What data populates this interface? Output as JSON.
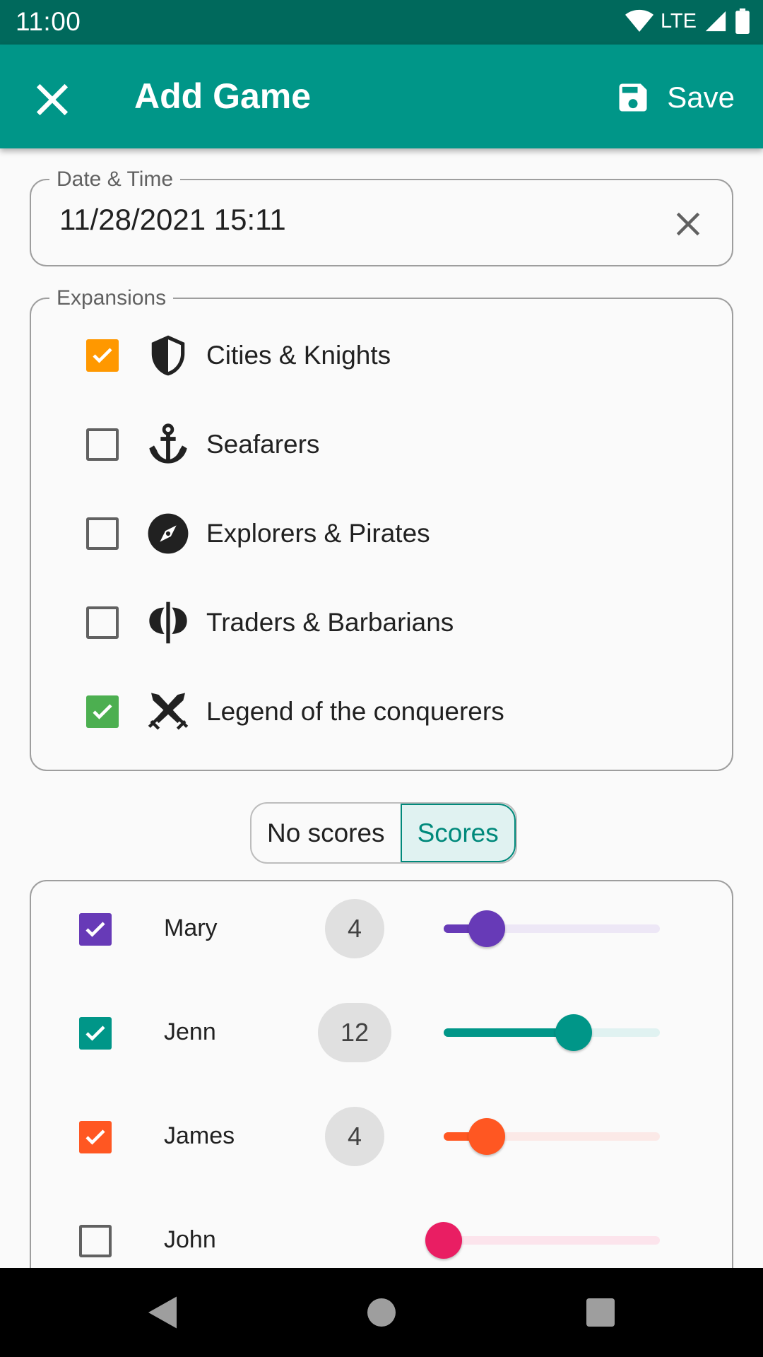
{
  "status_bar": {
    "time": "11:00",
    "network": "LTE"
  },
  "app_bar": {
    "title": "Add Game",
    "save_label": "Save"
  },
  "date_field": {
    "legend": "Date & Time",
    "value": "11/28/2021 15:11"
  },
  "expansions": {
    "legend": "Expansions",
    "items": [
      {
        "label": "Cities & Knights",
        "checked": true,
        "color": "#ff9800",
        "icon": "shield-icon"
      },
      {
        "label": "Seafarers",
        "checked": false,
        "color": "#616161",
        "icon": "anchor-icon"
      },
      {
        "label": "Explorers & Pirates",
        "checked": false,
        "color": "#616161",
        "icon": "compass-icon"
      },
      {
        "label": "Traders & Barbarians",
        "checked": false,
        "color": "#616161",
        "icon": "axe-icon"
      },
      {
        "label": "Legend of the conquerers",
        "checked": true,
        "color": "#4caf50",
        "icon": "crossed-swords-icon"
      }
    ]
  },
  "score_toggle": {
    "options": [
      "No scores",
      "Scores"
    ],
    "selected": "Scores"
  },
  "players": [
    {
      "name": "Mary",
      "checked": true,
      "score": "4",
      "slider_fraction": 0.2,
      "color": "#673ab7",
      "track": "#ede7f6"
    },
    {
      "name": "Jenn",
      "checked": true,
      "score": "12",
      "slider_fraction": 0.6,
      "color": "#009688",
      "track": "#e0f2f1"
    },
    {
      "name": "James",
      "checked": true,
      "score": "4",
      "slider_fraction": 0.2,
      "color": "#ff5722",
      "track": "#fbe9e7"
    },
    {
      "name": "John",
      "checked": false,
      "score": "",
      "slider_fraction": 0.0,
      "color": "#e91e63",
      "track": "#fce4ec"
    }
  ],
  "colors": {
    "status_bar": "#00695c",
    "app_bar": "#009688",
    "accent": "#009688"
  }
}
